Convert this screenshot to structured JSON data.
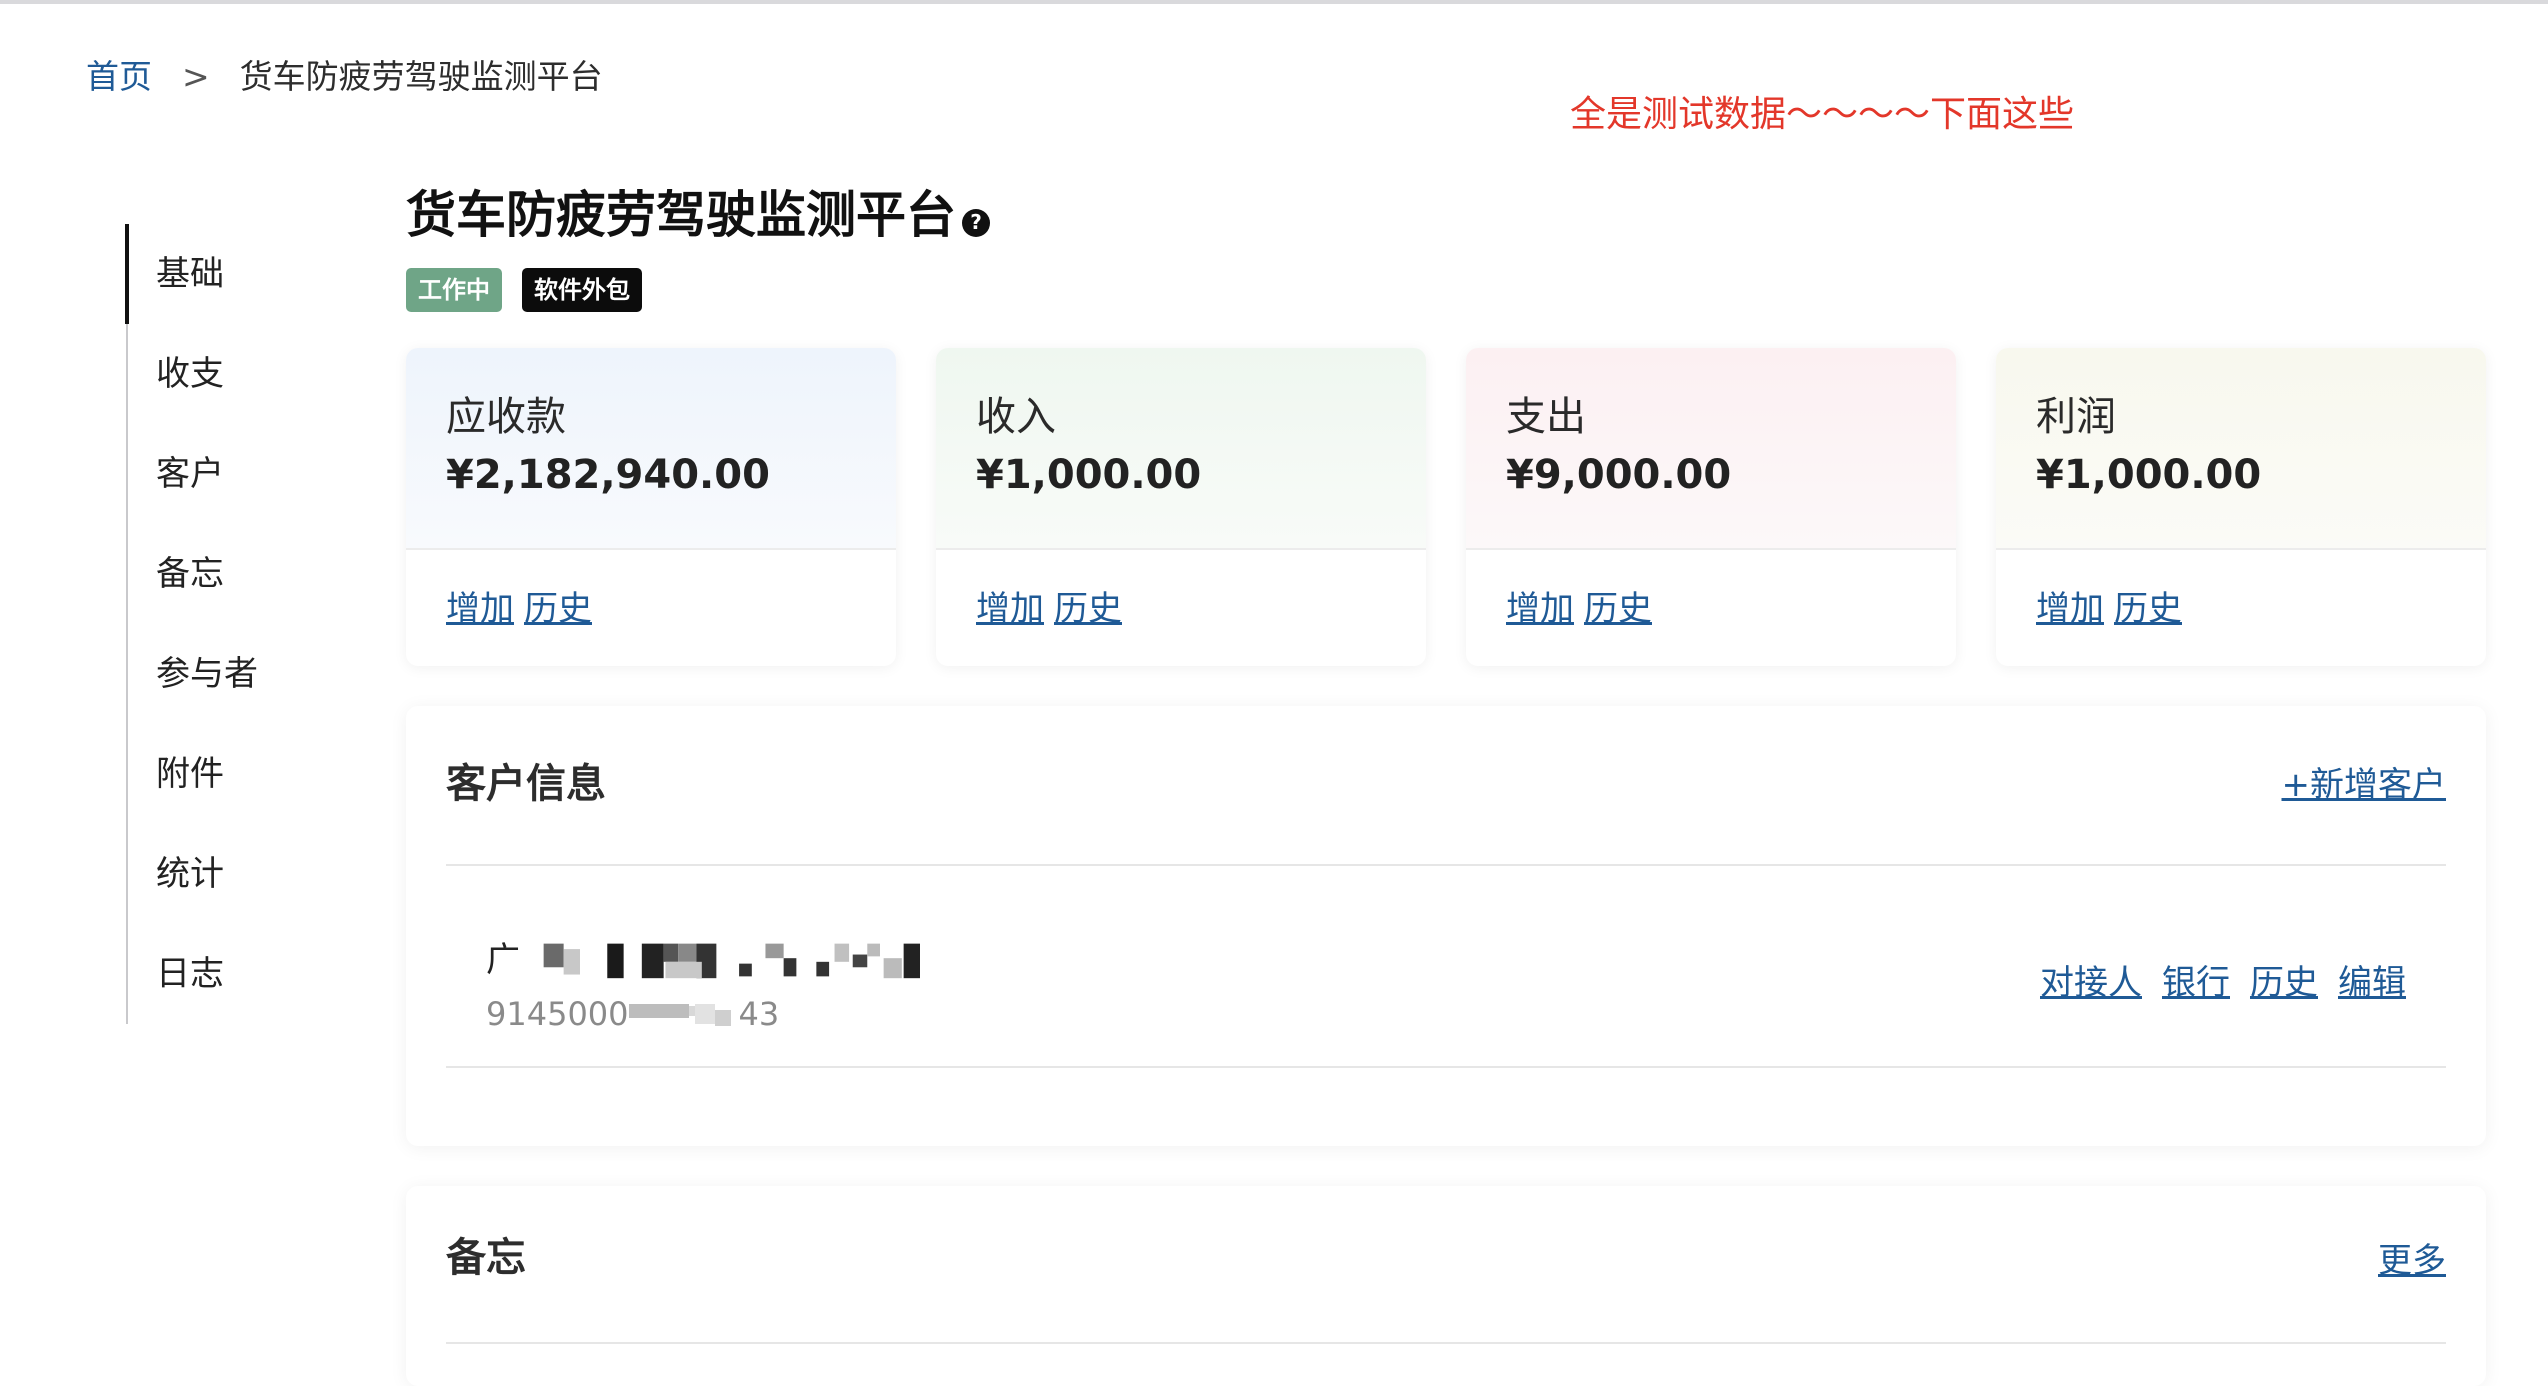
{
  "breadcrumb": {
    "home": "首页",
    "separator": ">",
    "current": "货车防疲劳驾驶监测平台"
  },
  "annotation": "全是测试数据～～～～下面这些",
  "sidebar": {
    "items": [
      {
        "label": "基础",
        "active": true
      },
      {
        "label": "收支"
      },
      {
        "label": "客户"
      },
      {
        "label": "备忘"
      },
      {
        "label": "参与者"
      },
      {
        "label": "附件"
      },
      {
        "label": "统计"
      },
      {
        "label": "日志"
      }
    ]
  },
  "project": {
    "title": "货车防疲劳驾驶监测平台",
    "help_icon": "?",
    "tags": [
      "工作中",
      "软件外包"
    ]
  },
  "cards": [
    {
      "label": "应收款",
      "amount": "¥2,182,940.00",
      "add": "增加",
      "history": "历史",
      "tint": "#eef4fc"
    },
    {
      "label": "收入",
      "amount": "¥1,000.00",
      "add": "增加",
      "history": "历史",
      "tint": "#eff7f0"
    },
    {
      "label": "支出",
      "amount": "¥9,000.00",
      "add": "增加",
      "history": "历史",
      "tint": "#fcf0f2"
    },
    {
      "label": "利润",
      "amount": "¥1,000.00",
      "add": "增加",
      "history": "历史",
      "tint": "#f8f8ee"
    }
  ],
  "customers": {
    "title": "客户信息",
    "add_label": "+新增客户",
    "rows": [
      {
        "name_visible": "广",
        "code_prefix": "9145000",
        "code_suffix": "43",
        "actions": [
          "对接人",
          "银行",
          "历史",
          "编辑"
        ]
      }
    ]
  },
  "memo": {
    "title": "备忘",
    "more_label": "更多"
  },
  "colors": {
    "link": "#1f5a96",
    "annotation": "#e3372a",
    "tag_working": "#6fa587",
    "tag_type": "#0c0c0c"
  }
}
